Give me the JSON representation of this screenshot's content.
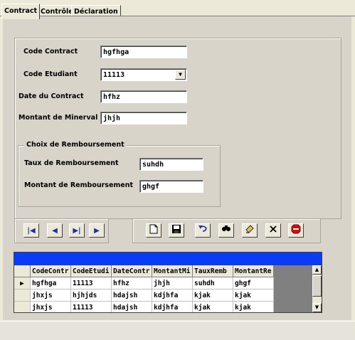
{
  "tabs": [
    "Contract",
    "Contrôle",
    "Déclaration"
  ],
  "form": {
    "code_contract": {
      "label": "Code Contract",
      "value": "hgfhga"
    },
    "code_etudiant": {
      "label": "Code Etudiant",
      "value": "11113"
    },
    "date_contract": {
      "label": "Date du Contract",
      "value": "hfhz"
    },
    "montant_minerval": {
      "label": "Montant de Minerval",
      "value": "jhjh"
    }
  },
  "remboursement": {
    "title": "Choix de Remboursement",
    "taux": {
      "label": "Taux de Remboursement",
      "value": "suhdh"
    },
    "montant": {
      "label": "Montant de Remboursement",
      "value": "ghgf"
    }
  },
  "navigation_icons": [
    "first-record-icon",
    "previous-record-icon",
    "next-record-icon",
    "last-record-icon"
  ],
  "toolbar_icons": [
    "new-document-icon",
    "save-icon",
    "undo-icon",
    "search-icon",
    "edit-icon",
    "delete-icon",
    "stop-icon"
  ],
  "grid": {
    "columns": [
      "CodeContr",
      "CodeEtudi",
      "DateContr",
      "MontantMi",
      "TauxRemb",
      "MontantRe"
    ],
    "rows": [
      [
        "hgfhga",
        "11113",
        "hfhz",
        "jhjh",
        "suhdh",
        "ghgf"
      ],
      [
        "jhxjs",
        "hjhjds",
        "hdajsh",
        "kdjhfa",
        "kjak",
        "kjak"
      ],
      [
        "jhxjs",
        "11113",
        "hdajsh",
        "kdjhfa",
        "kjak",
        "kjak"
      ]
    ]
  },
  "colors": {
    "grid_caption": "#0A3BF5",
    "nav_icon": "#1F2FA8",
    "stop_icon": "#D01010"
  }
}
